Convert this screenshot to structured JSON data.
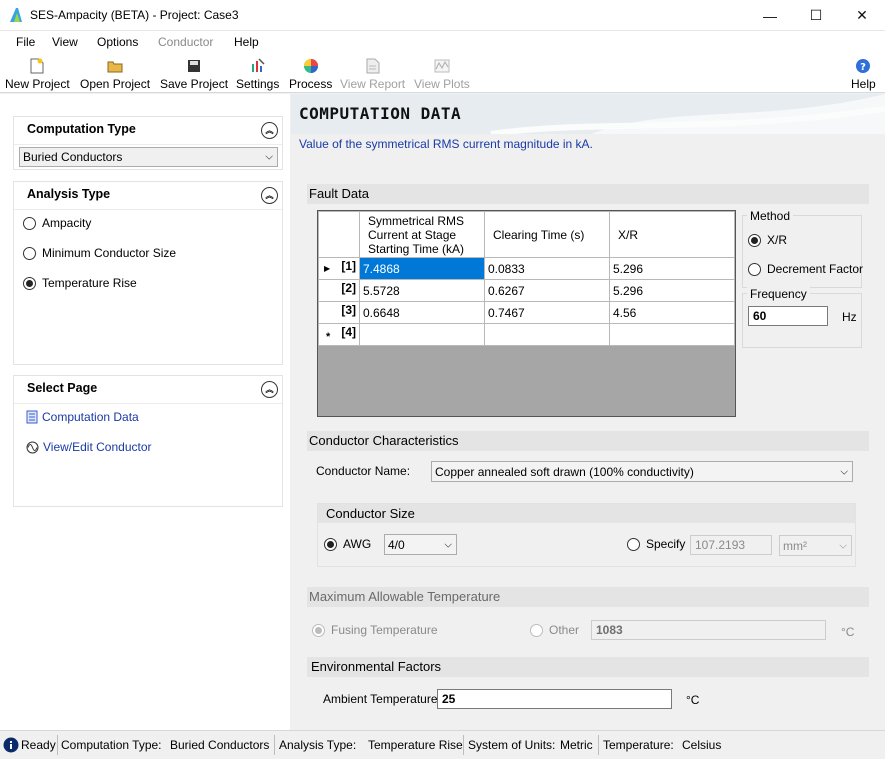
{
  "window": {
    "title": "SES-Ampacity (BETA) - Project:  Case3",
    "minimize": "—",
    "maximize": "☐",
    "close": "✕"
  },
  "menu": [
    "File",
    "View",
    "Options",
    "Conductor",
    "Help"
  ],
  "toolbar": {
    "new_project": "New Project",
    "open_project": "Open Project",
    "save_project": "Save Project",
    "settings": "Settings",
    "process": "Process",
    "view_report": "View Report",
    "view_plots": "View Plots",
    "help": "Help"
  },
  "left": {
    "computation_type": {
      "header": "Computation Type",
      "selected": "Buried Conductors"
    },
    "analysis_type": {
      "header": "Analysis Type",
      "options": [
        "Ampacity",
        "Minimum Conductor Size",
        "Temperature Rise"
      ],
      "selected": "Temperature Rise"
    },
    "select_page": {
      "header": "Select Page",
      "links": [
        "Computation Data",
        "View/Edit Conductor"
      ]
    }
  },
  "main": {
    "title": "COMPUTATION DATA",
    "description": "Value of the symmetrical RMS current magnitude in kA.",
    "fault_data": {
      "header": "Fault Data",
      "columns": [
        "Symmetrical RMS Current at Stage Starting Time (kA)",
        "Clearing Time (s)",
        "X/R"
      ],
      "rows": [
        {
          "index": "[1]",
          "current": "7.4868",
          "time": "0.0833",
          "xr": "5.296"
        },
        {
          "index": "[2]",
          "current": "5.5728",
          "time": "0.6267",
          "xr": "5.296"
        },
        {
          "index": "[3]",
          "current": "0.6648",
          "time": "0.7467",
          "xr": "4.56"
        },
        {
          "index": "[4]",
          "current": "",
          "time": "",
          "xr": ""
        }
      ],
      "method": {
        "label": "Method",
        "options": [
          "X/R",
          "Decrement Factor"
        ],
        "selected": "X/R"
      },
      "frequency": {
        "label": "Frequency",
        "value": "60",
        "unit": "Hz"
      }
    },
    "conductor_characteristics": {
      "header": "Conductor Characteristics",
      "name_label": "Conductor Name:",
      "name_value": "Copper annealed soft drawn (100% conductivity)",
      "size": {
        "header": "Conductor Size",
        "awg_label": "AWG",
        "awg_value": "4/0",
        "specify_label": "Specify",
        "specify_value": "107.2193",
        "specify_unit": "mm²"
      }
    },
    "max_temp": {
      "header": "Maximum Allowable Temperature",
      "fusing_label": "Fusing Temperature",
      "other_label": "Other",
      "other_value": "1083",
      "unit": "°C"
    },
    "environment": {
      "header": "Environmental Factors",
      "ambient_label": "Ambient Temperature:",
      "ambient_value": "25",
      "unit": "°C"
    }
  },
  "status": {
    "ready": "Ready",
    "computation_type_label": "Computation Type:",
    "computation_type": "Buried Conductors",
    "analysis_type_label": "Analysis Type:",
    "analysis_type": "Temperature Rise",
    "units_label": "System of Units:",
    "units": "Metric",
    "temperature_label": "Temperature:",
    "temperature": "Celsius"
  }
}
